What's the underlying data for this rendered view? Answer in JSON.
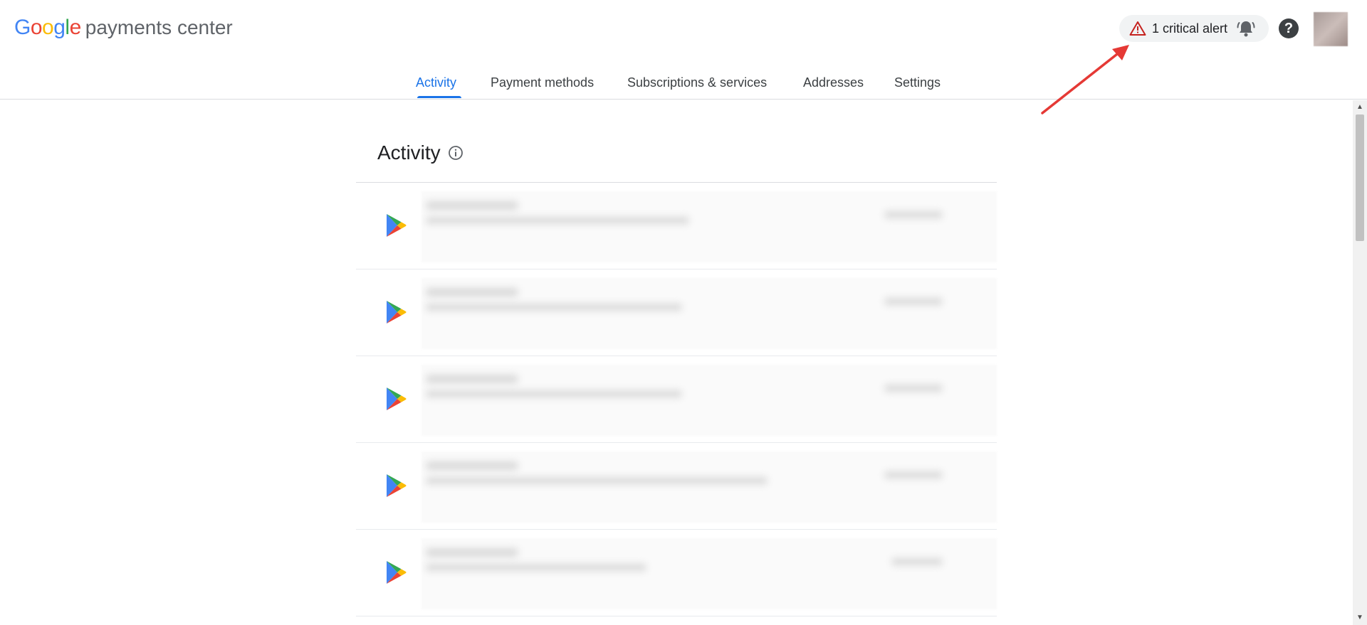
{
  "header": {
    "logo": {
      "google_letters": [
        "G",
        "o",
        "o",
        "g",
        "l",
        "e"
      ],
      "product_name": "payments center"
    },
    "alert_chip": {
      "label": "1 critical alert",
      "warning_icon": "warning-triangle-icon",
      "bell_icon": "bell-ringing-icon"
    },
    "help": {
      "glyph": "?",
      "icon": "help-circle-icon"
    },
    "avatar": "avatar"
  },
  "tabs": [
    {
      "label": "Activity",
      "active": true
    },
    {
      "label": "Payment methods",
      "active": false
    },
    {
      "label": "Subscriptions & services",
      "active": false
    },
    {
      "label": "Addresses",
      "active": false
    },
    {
      "label": "Settings",
      "active": false
    }
  ],
  "main": {
    "title": "Activity",
    "title_icon": "info-icon",
    "rows": [
      {
        "icon": "google-play-icon"
      },
      {
        "icon": "google-play-icon"
      },
      {
        "icon": "google-play-icon"
      },
      {
        "icon": "google-play-icon"
      },
      {
        "icon": "google-play-icon"
      }
    ]
  },
  "colors": {
    "accent": "#1a73e8",
    "alert_red": "#c5221f",
    "annotation_arrow": "#e53935",
    "chip_bg": "#f1f3f4"
  }
}
